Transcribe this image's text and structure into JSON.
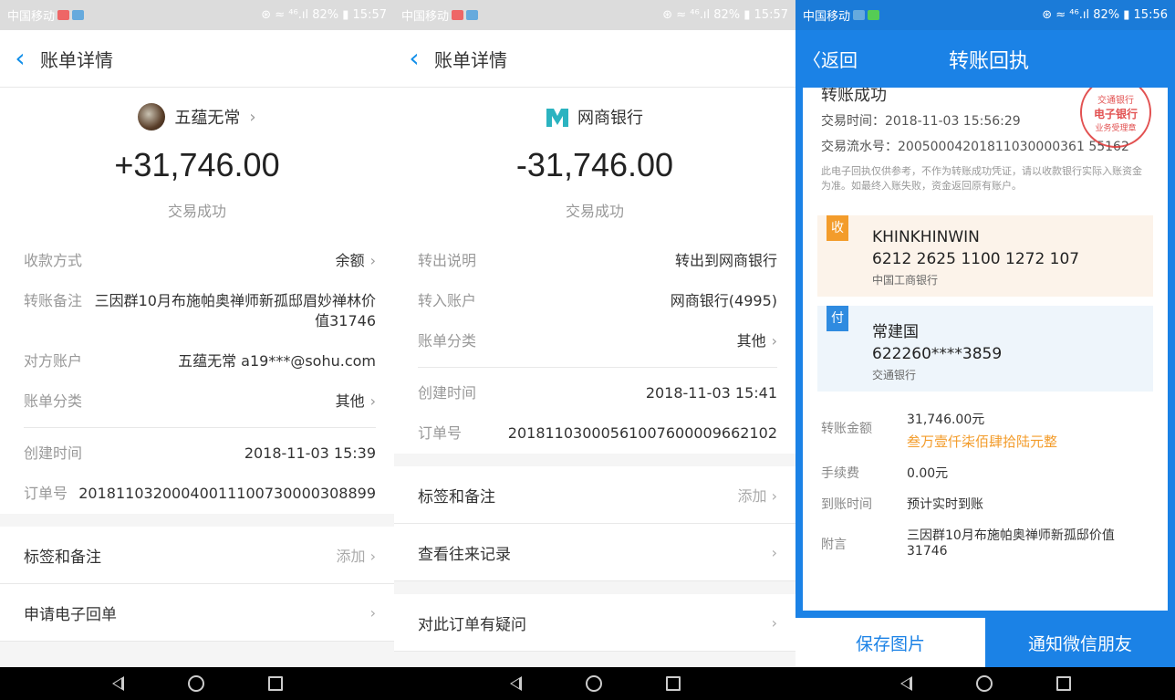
{
  "status_bar": {
    "p1": {
      "carrier": "中国移动",
      "right": "⊛ ≈ ⁴⁶.ıl 82% ▮ 15:57"
    },
    "p2": {
      "carrier": "中国移动",
      "right": "⊛ ≈ ⁴⁶.ıl 82% ▮ 15:57"
    },
    "p3": {
      "carrier": "中国移动",
      "right": "⊛ ≈ ⁴⁶.ıl 82% ▮ 15:56"
    }
  },
  "panel1": {
    "title": "账单详情",
    "counterparty": "五蕴无常",
    "amount": "+31,746.00",
    "status": "交易成功",
    "rows": [
      {
        "k": "收款方式",
        "v": "余额",
        "arrow": true
      },
      {
        "k": "转账备注",
        "v": "三因群10月布施帕奥禅师新孤邸眉妙禅林价值31746",
        "arrow": false
      },
      {
        "k": "对方账户",
        "v": "五蕴无常 a19***@sohu.com",
        "arrow": false
      },
      {
        "k": "账单分类",
        "v": "其他",
        "arrow": true
      }
    ],
    "rows2": [
      {
        "k": "创建时间",
        "v": "2018-11-03 15:39"
      },
      {
        "k": "订单号",
        "v": "2018110320004001110073000030​8899"
      }
    ],
    "tags_label": "标签和备注",
    "tags_hint": "添加",
    "e_receipt": "申请电子回单"
  },
  "panel2": {
    "title": "账单详情",
    "counterparty": "网商银行",
    "amount": "-31,746.00",
    "status": "交易成功",
    "rows": [
      {
        "k": "转出说明",
        "v": "转出到网商银行",
        "arrow": false
      },
      {
        "k": "转入账户",
        "v": "网商银行(4995)",
        "arrow": false
      },
      {
        "k": "账单分类",
        "v": "其他",
        "arrow": true
      }
    ],
    "rows2": [
      {
        "k": "创建时间",
        "v": "2018-11-03 15:41"
      },
      {
        "k": "订单号",
        "v": "20181103000561007600009662102"
      }
    ],
    "tags_label": "标签和备注",
    "tags_hint": "添加",
    "history": "查看往来记录",
    "question": "对此订单有疑问"
  },
  "panel3": {
    "back": "〈返回",
    "title": "转账回执",
    "success": "转账成功",
    "time": "交易时间：2018-11-03 15:56:29",
    "serial": "交易流水号：20050004201811030000361 55162",
    "note": "此电子回执仅供参考，不作为转账成功凭证，请以收款银行实际入账资金为准。如最终入账失败，资金返回原有账户。",
    "stamp": {
      "top": "交通银行",
      "mid": "电子银行",
      "bot": "业务受理章"
    },
    "receiver": {
      "tag": "收",
      "name": "KHINKHINWIN",
      "account": "6212 2625 1100 1272 107",
      "bank": "中国工商银行"
    },
    "payer": {
      "tag": "付",
      "name": "常建国",
      "account": "622260****3859",
      "bank": "交通银行"
    },
    "amount_k": "转账金额",
    "amount_v": "31,746.00元",
    "amount_cn": "叁万壹仟柒佰肆拾陆元整",
    "fee_k": "手续费",
    "fee_v": "0.00元",
    "arrive_k": "到账时间",
    "arrive_v": "预计实时到账",
    "memo_k": "附言",
    "memo_v": "三因群10月布施帕奥禅师新孤邸价值31746",
    "save": "保存图片",
    "notify": "通知微信朋友"
  }
}
